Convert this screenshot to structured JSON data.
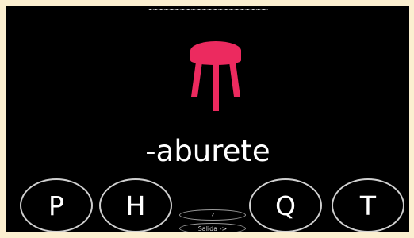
{
  "game": {
    "top_decoration": "~~~~~~~~~~~~~~~~~~~~~~",
    "word": "-aburete",
    "picture": {
      "icon": "stool-icon",
      "color": "#ec2a5f"
    },
    "choices": [
      "P",
      "H",
      "Q",
      "T"
    ],
    "help_label": "?",
    "exit_label": "Salida ->"
  },
  "colors": {
    "background": "#000000",
    "border": "#fbefd0",
    "text": "#ffffff"
  }
}
